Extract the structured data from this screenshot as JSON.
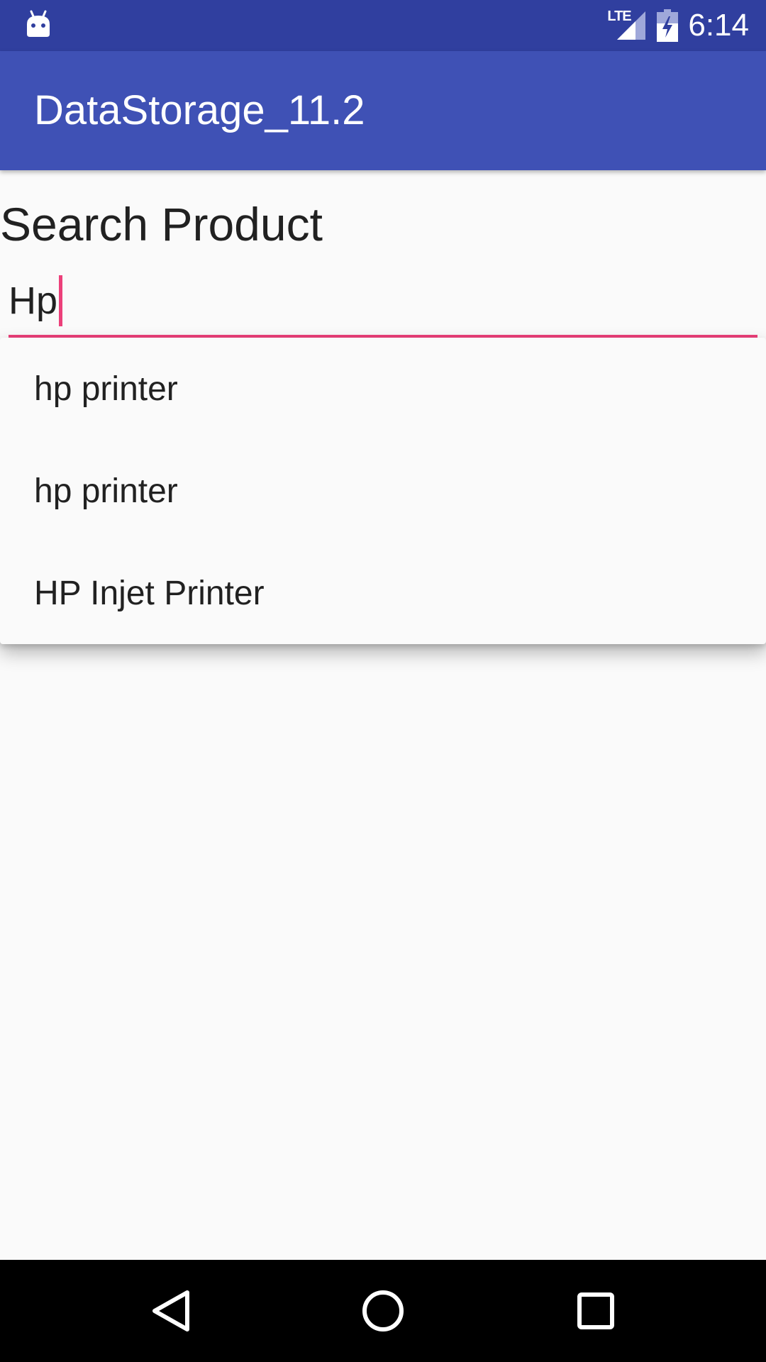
{
  "status_bar": {
    "network_label": "LTE",
    "time": "6:14",
    "icons": [
      "android-notification-icon",
      "lte-signal-icon",
      "battery-charging-icon"
    ]
  },
  "app_bar": {
    "title": "DataStorage_11.2"
  },
  "main": {
    "heading": "Search Product",
    "search": {
      "value": "Hp"
    },
    "suggestions": [
      {
        "label": "hp printer"
      },
      {
        "label": "hp printer"
      },
      {
        "label": "HP Injet Printer"
      }
    ]
  },
  "nav_bar": {
    "icons": [
      "back-icon",
      "home-icon",
      "recents-icon"
    ]
  },
  "colors": {
    "status_bar": "#303f9f",
    "app_bar": "#3f51b5",
    "accent": "#ec407a",
    "background": "#fafafa"
  }
}
